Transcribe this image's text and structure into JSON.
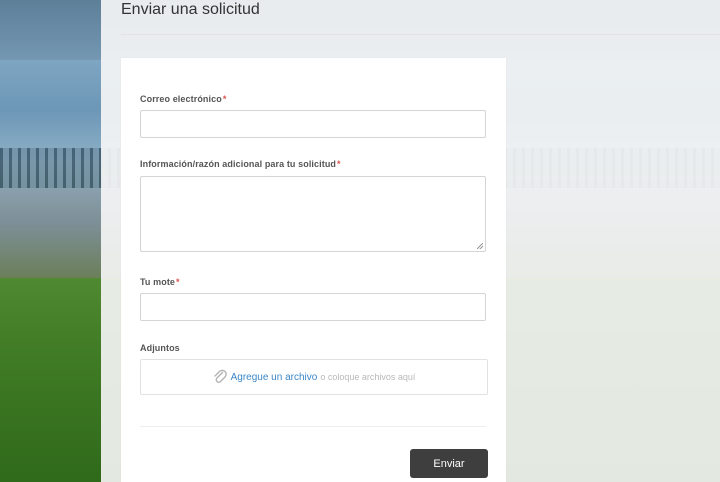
{
  "page": {
    "title": "Enviar una solicitud"
  },
  "form": {
    "email": {
      "label": "Correo electrónico",
      "required_mark": "*",
      "value": ""
    },
    "info": {
      "label": "Información/razón adicional para tu solicitud",
      "required_mark": "*",
      "value": ""
    },
    "nickname": {
      "label": "Tu mote",
      "required_mark": "*",
      "value": ""
    },
    "attachments": {
      "label": "Adjuntos",
      "link_text": "Agregue un archivo",
      "rest_text": "o coloque archivos aquí",
      "icon": "paperclip-icon"
    },
    "submit_label": "Enviar"
  },
  "colors": {
    "required": "#d9534f",
    "link": "#3b87c8",
    "button_bg": "#3e3e3e"
  }
}
